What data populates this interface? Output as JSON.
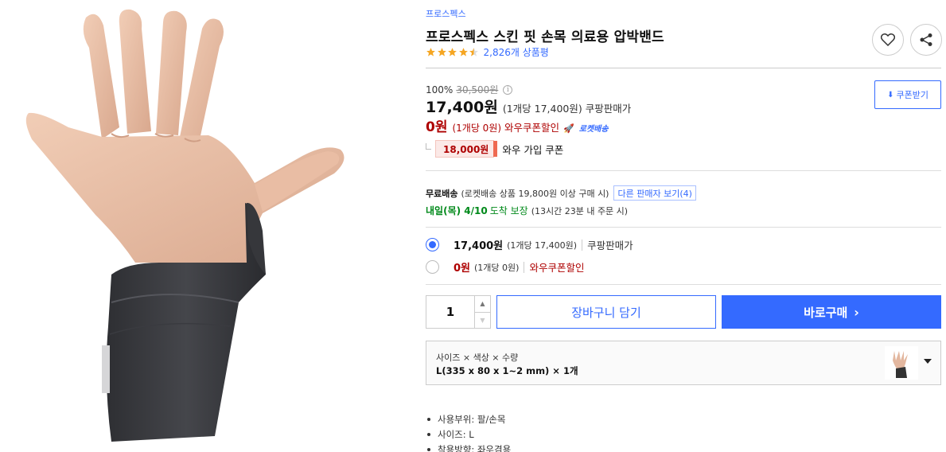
{
  "product": {
    "brand": "프로스펙스",
    "title": "프로스펙스 스킨 핏 손목 의료용 압박밴드",
    "rating_stars": 4.5,
    "review_count": "2,826개 상품평",
    "image_alt": "hand-with-black-wrist-compression-band"
  },
  "actions": {
    "wishlist_icon": "heart-icon",
    "share_icon": "share-icon",
    "coupon_button": "쿠폰받기"
  },
  "pricing": {
    "discount_rate": "100%",
    "original_price": "30,500원",
    "price": "17,400원",
    "unit_price": "(1개당 17,400원)",
    "seller_type": "쿠팡판매가",
    "wow_price": "0원",
    "wow_unit_price": "(1개당 0원)",
    "wow_label": "와우쿠폰할인",
    "rocket_label": "로켓배송",
    "join_coupon_amount": "18,000원",
    "join_coupon_label": "와우 가입 쿠폰"
  },
  "shipping": {
    "free_label": "무료배송",
    "condition": "(로켓배송 상품 19,800원 이상 구매 시)",
    "other_sellers": "다른 판매자 보기(4)",
    "arrival_date": "내일(목) 4/10",
    "arrival_guarantee": "도착 보장",
    "arrival_condition": "(13시간 23분 내 주문 시)"
  },
  "price_options": [
    {
      "price": "17,400원",
      "unit": "(1개당 17,400원)",
      "label": "쿠팡판매가",
      "selected": true
    },
    {
      "price": "0원",
      "unit": "(1개당 0원)",
      "label": "와우쿠폰할인",
      "selected": false
    }
  ],
  "purchase": {
    "quantity": "1",
    "cart_button": "장바구니 담기",
    "buy_button": "바로구매",
    "buy_chevron": "›"
  },
  "option_selector": {
    "header": "사이즈 × 색상 × 수량",
    "value": "L(335 x 80 x 1~2 mm) × 1개"
  },
  "specs": [
    "사용부위: 팔/손목",
    "사이즈: L",
    "착용방향: 좌우겸용"
  ],
  "colors": {
    "accent_blue": "#346aff",
    "wow_red": "#ae0000",
    "arrival_green": "#00891a",
    "star_orange": "#f5a623"
  }
}
